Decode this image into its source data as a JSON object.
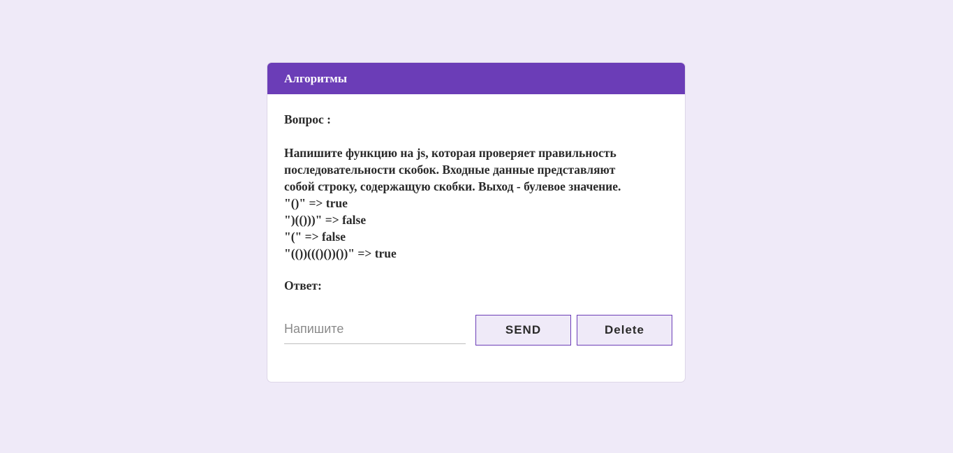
{
  "card": {
    "title": "Алгоритмы"
  },
  "question": {
    "label": "Вопрос :",
    "lines": [
      "Напишите функцию на js, которая проверяет правильность",
      "последовательности скобок. Входные данные представляют",
      "собой строку, содержащую скобки. Выход - булевое значение.",
      "\"()\" => true",
      "\")(()))\" => false",
      "\"(\" => false",
      "\"(())((()())())\" => true"
    ]
  },
  "answer": {
    "label": "Ответ:",
    "placeholder": "Напишите",
    "value": "",
    "send_label": "SEND",
    "delete_label": "Delete"
  },
  "colors": {
    "background": "#efeaf8",
    "header": "#6b3db7",
    "accent": "#6b3db7"
  }
}
